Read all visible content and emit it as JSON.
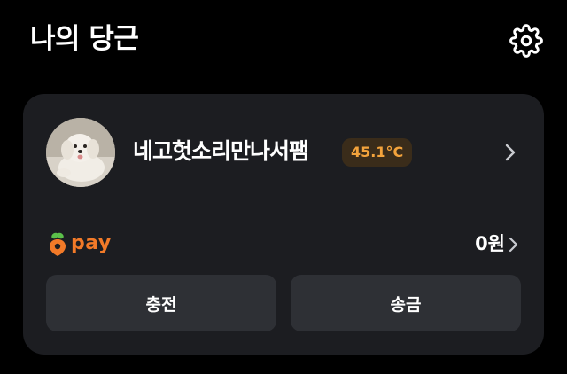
{
  "header": {
    "title": "나의 당근",
    "settings_icon": "gear-icon"
  },
  "profile": {
    "nickname": "네고헛소리만나서팸",
    "manner_temperature": "45.1°C",
    "avatar": "dog-photo-avatar"
  },
  "pay": {
    "brand": "pay",
    "balance": "0원"
  },
  "actions": {
    "charge_label": "충전",
    "send_label": "송금"
  },
  "colors": {
    "background": "#000000",
    "card": "#1c1d21",
    "button": "#2e3035",
    "accent_orange": "#f27a28",
    "temperature_text": "#f3a33c",
    "temperature_badge": "#3a2c1a"
  }
}
